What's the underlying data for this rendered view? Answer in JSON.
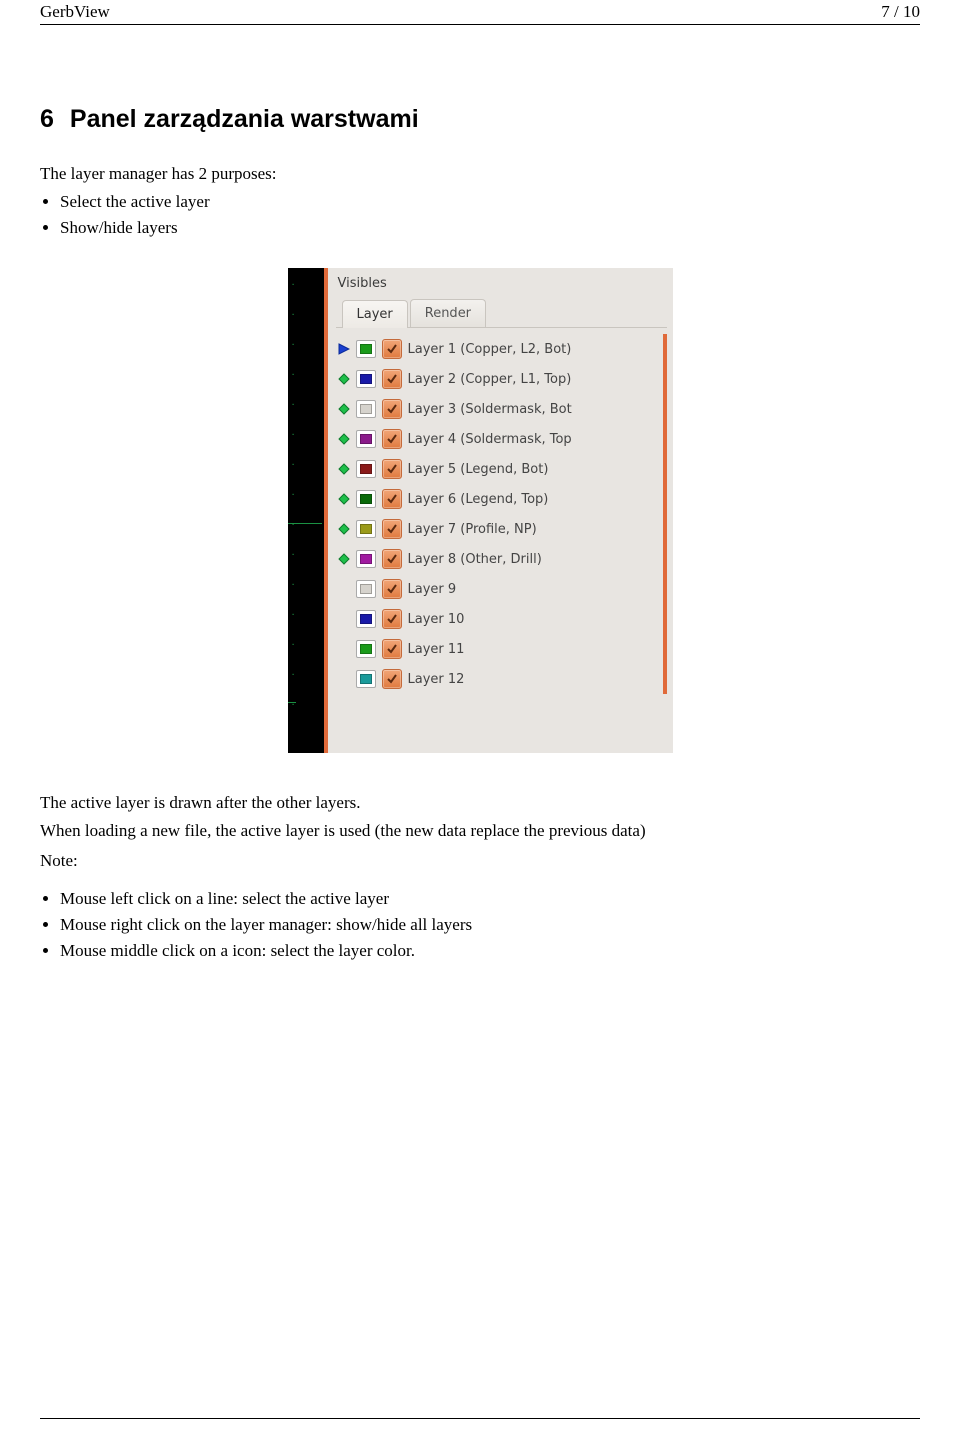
{
  "header": {
    "title": "GerbView",
    "page": "7 / 10"
  },
  "section": {
    "num": "6",
    "title": "Panel zarządzania warstwami"
  },
  "intro": "The layer manager has 2 purposes:",
  "purposes": [
    "Select the active layer",
    "Show/hide layers"
  ],
  "after_image": {
    "line1": "The active layer is drawn after the other layers.",
    "line2": "When loading a new file, the active layer is used (the new data replace the previous data)",
    "note": "Note:"
  },
  "notes": [
    "Mouse left click on a line: select the active layer",
    "Mouse right click on the layer manager: show/hide all layers",
    "Mouse middle click on a icon: select the layer color."
  ],
  "panel": {
    "title": "Visibles",
    "tabs": {
      "layer": "Layer",
      "render": "Render"
    },
    "layers": [
      {
        "label": "Layer 1 (Copper, L2, Bot)",
        "color": "#1a9a1a",
        "arrow": "active"
      },
      {
        "label": "Layer 2 (Copper, L1, Top)",
        "color": "#1a1aa8",
        "arrow": "diamond"
      },
      {
        "label": "Layer 3 (Soldermask, Bot",
        "color": "#d6d3cd",
        "arrow": "diamond"
      },
      {
        "label": "Layer 4 (Soldermask, Top",
        "color": "#8a1a8a",
        "arrow": "diamond"
      },
      {
        "label": "Layer 5 (Legend, Bot)",
        "color": "#8a1a1a",
        "arrow": "diamond"
      },
      {
        "label": "Layer 6 (Legend, Top)",
        "color": "#0a6a0a",
        "arrow": "diamond"
      },
      {
        "label": "Layer 7 (Profile, NP)",
        "color": "#9a9a1a",
        "arrow": "diamond"
      },
      {
        "label": "Layer 8 (Other, Drill)",
        "color": "#a01aa0",
        "arrow": "diamond"
      },
      {
        "label": "Layer 9",
        "color": "#d6d3cd",
        "arrow": "none"
      },
      {
        "label": "Layer 10",
        "color": "#1a1aa8",
        "arrow": "none"
      },
      {
        "label": "Layer 11",
        "color": "#1a9a1a",
        "arrow": "none"
      },
      {
        "label": "Layer 12",
        "color": "#1a9a9a",
        "arrow": "none"
      }
    ]
  }
}
